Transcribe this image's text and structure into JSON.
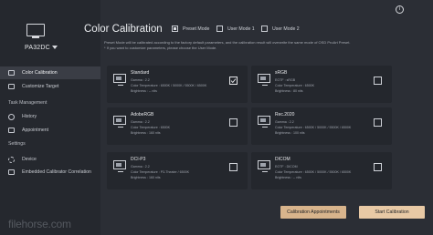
{
  "sidebar": {
    "model": "PA32DC",
    "items": [
      {
        "label": "Color Calibration",
        "icon": "color-calibration-icon",
        "active": true
      },
      {
        "label": "Customize Target",
        "icon": "customize-target-icon",
        "active": false
      }
    ],
    "sections": {
      "task_management": {
        "title": "Task Management",
        "items": [
          {
            "label": "History",
            "icon": "history-icon"
          },
          {
            "label": "Appointment",
            "icon": "appointment-icon"
          }
        ]
      },
      "settings": {
        "title": "Settings",
        "items": [
          {
            "label": "Device",
            "icon": "gear-icon"
          },
          {
            "label": "Embedded Calibrator Correlation",
            "icon": "correlation-icon"
          }
        ]
      }
    }
  },
  "main": {
    "title": "Color Calibration",
    "modes": [
      {
        "label": "Preset Mode",
        "checked": true
      },
      {
        "label": "User Mode 1",
        "checked": false
      },
      {
        "label": "User Mode 2",
        "checked": false
      }
    ],
    "description": [
      "Preset Mode will be calibrated according to the factory default parameters, and the calibration result will overwrite the same mode of OSD ProArt Preset.",
      "* If you want to customize parameters, please choose the User Mode."
    ],
    "cards": [
      {
        "name": "Standard",
        "specs": [
          "Gamma : 2.2",
          "Color Temperature : 6500K / 5000K / 5500K / 6500K",
          "Brightness : -- nits"
        ],
        "selected": true
      },
      {
        "name": "sRGB",
        "specs": [
          "EOTF : sRGB",
          "Color Temperature : 6500K",
          "Brightness : 80 nits"
        ],
        "selected": false
      },
      {
        "name": "AdobeRGB",
        "specs": [
          "Gamma : 2.2",
          "Color Temperature : 6500K",
          "Brightness : 160 nits"
        ],
        "selected": false
      },
      {
        "name": "Rec.2020",
        "specs": [
          "Gamma : 2.2",
          "Color Temperature : 6500K / 5000K / 5500K / 6500K",
          "Brightness : 100 nits"
        ],
        "selected": false
      },
      {
        "name": "DCI-P3",
        "specs": [
          "Gamma : 2.2",
          "Color Temperature : P3-Theater / 6500K",
          "Brightness : 160 nits"
        ],
        "selected": false
      },
      {
        "name": "DICOM",
        "specs": [
          "EOTF : DICOM",
          "Color Temperature : 6500K / 5000K / 5500K / 6500K",
          "Brightness : -- nits"
        ],
        "selected": false
      }
    ],
    "buttons": {
      "appointments": "Calibration Appointments",
      "start": "Start Calibration"
    }
  },
  "watermark": "filehorse.com"
}
